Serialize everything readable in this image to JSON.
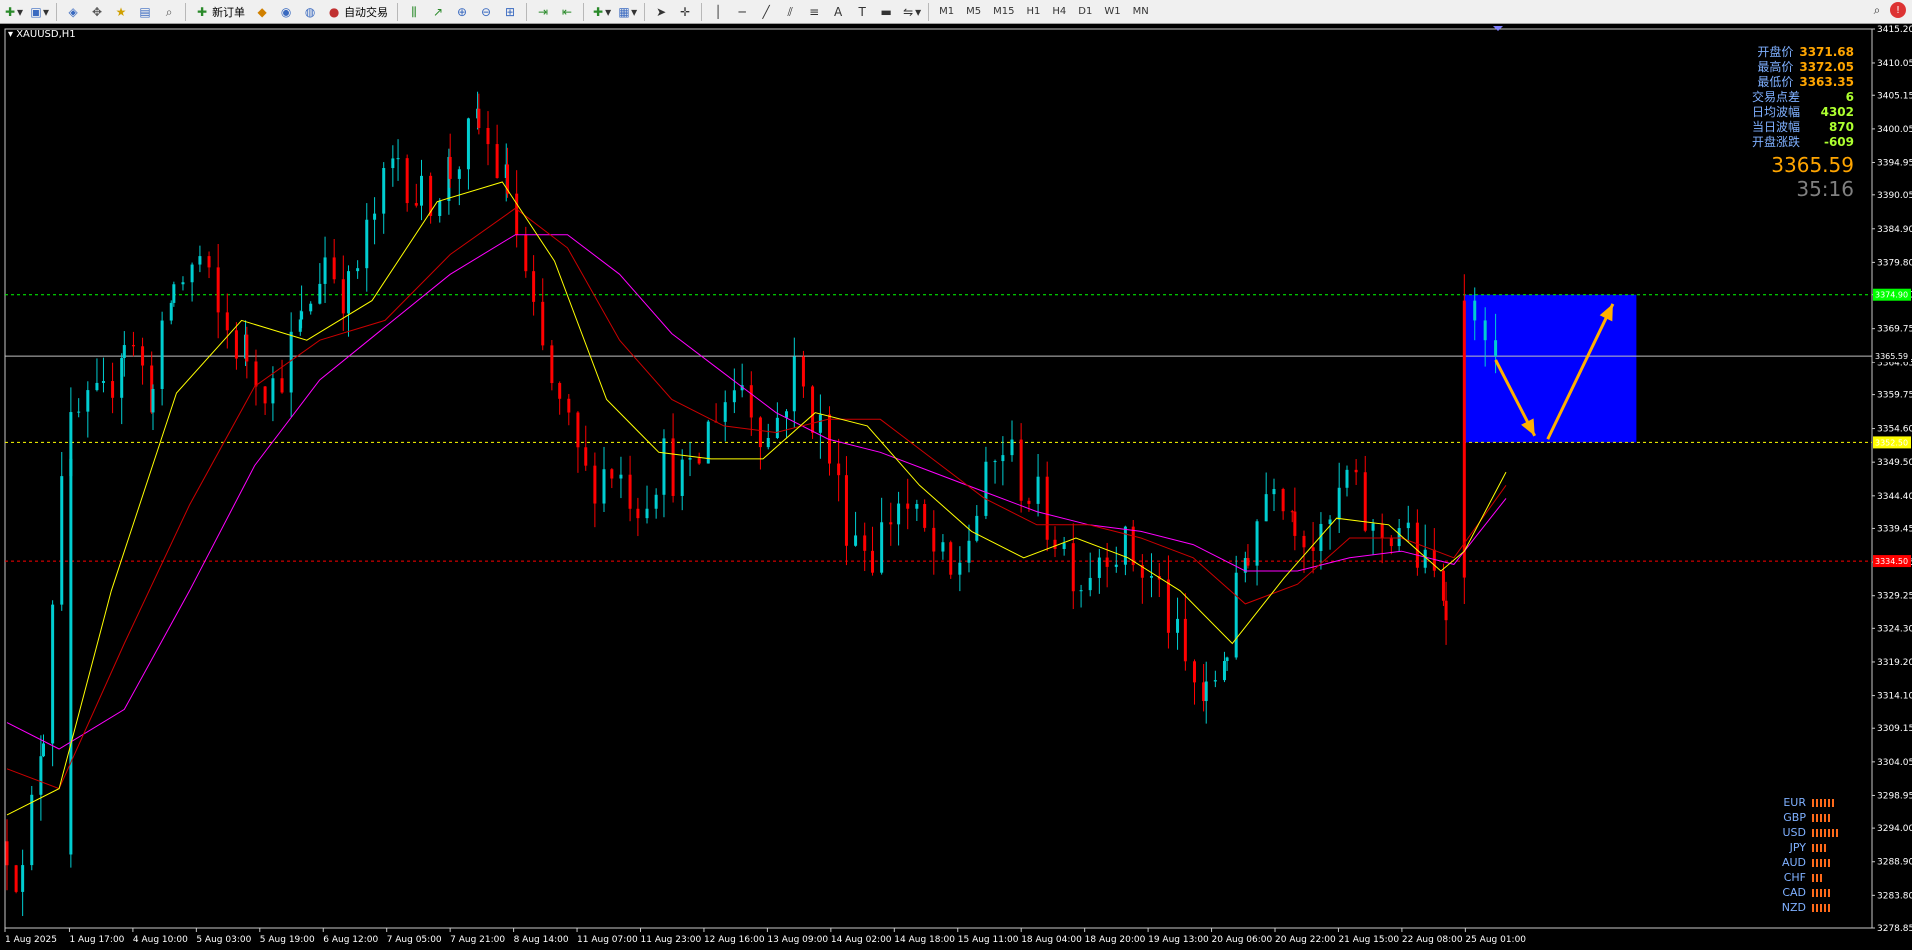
{
  "toolbar": {
    "new_order_label": "新订单",
    "auto_trading_label": "自动交易",
    "timeframes": [
      "M1",
      "M5",
      "M15",
      "H1",
      "H4",
      "D1",
      "W1",
      "MN"
    ]
  },
  "chart": {
    "symbol_label": "XAUUSD,H1",
    "colors": {
      "bull": "#00ced1",
      "bear": "#ff0000",
      "ma_fast": "#ffff00",
      "ma_mid": "#cc0000",
      "ma_slow": "#ff00ff",
      "box": "#0000ff",
      "arrow": "#ffb000"
    }
  },
  "info_panel": {
    "rows": [
      {
        "label": "开盘价",
        "value": "3371.68"
      },
      {
        "label": "最高价",
        "value": "3372.05"
      },
      {
        "label": "最低价",
        "value": "3363.35"
      },
      {
        "label": "交易点差",
        "value": "6"
      },
      {
        "label": "日均波幅",
        "value": "4302"
      },
      {
        "label": "当日波幅",
        "value": "870"
      },
      {
        "label": "开盘涨跌",
        "value": "-609"
      }
    ],
    "price": "3365.59",
    "countdown": "35:16"
  },
  "currency_strength": [
    {
      "currency": "EUR",
      "bars": 6
    },
    {
      "currency": "GBP",
      "bars": 5
    },
    {
      "currency": "USD",
      "bars": 7
    },
    {
      "currency": "JPY",
      "bars": 4
    },
    {
      "currency": "AUD",
      "bars": 5
    },
    {
      "currency": "CHF",
      "bars": 3
    },
    {
      "currency": "CAD",
      "bars": 5
    },
    {
      "currency": "NZD",
      "bars": 5
    }
  ],
  "chart_data": {
    "type": "candlestick",
    "price_axis_labels": [
      "3415.20",
      "3410.05",
      "3405.15",
      "3400.05",
      "3394.95",
      "3390.05",
      "3384.90",
      "3379.80",
      "3374.90",
      "3369.75",
      "3364.65",
      "3359.75",
      "3354.60",
      "3349.50",
      "3344.40",
      "3339.45",
      "3334.35",
      "3329.25",
      "3324.30",
      "3319.20",
      "3314.10",
      "3309.15",
      "3304.05",
      "3298.95",
      "3294.00",
      "3288.90",
      "3283.80",
      "3278.85"
    ],
    "ylim": [
      3278.85,
      3415.2
    ],
    "time_labels": [
      "1 Aug 2025",
      "1 Aug 17:00",
      "4 Aug 10:00",
      "5 Aug 03:00",
      "5 Aug 19:00",
      "6 Aug 12:00",
      "7 Aug 05:00",
      "7 Aug 21:00",
      "8 Aug 14:00",
      "11 Aug 07:00",
      "11 Aug 23:00",
      "12 Aug 16:00",
      "13 Aug 09:00",
      "14 Aug 02:00",
      "14 Aug 18:00",
      "15 Aug 11:00",
      "18 Aug 04:00",
      "18 Aug 20:00",
      "19 Aug 13:00",
      "20 Aug 06:00",
      "20 Aug 22:00",
      "21 Aug 15:00",
      "22 Aug 08:00",
      "25 Aug 01:00"
    ],
    "horizontal_lines": [
      {
        "price": 3374.9,
        "label": "3374.90",
        "color": "#00ff00",
        "style": "dashed"
      },
      {
        "price": 3365.59,
        "label": "3365.59",
        "color": "#c0c0c0",
        "style": "solid"
      },
      {
        "price": 3352.5,
        "label": "3352.50",
        "color": "#ffff00",
        "style": "dashed"
      },
      {
        "price": 3334.5,
        "label": "3334.50",
        "color": "#ff0000",
        "style": "dashed"
      }
    ],
    "anchors": [
      [
        0,
        3292
      ],
      [
        12,
        3286
      ],
      [
        28,
        3310
      ],
      [
        42,
        3350
      ],
      [
        55,
        3356
      ],
      [
        74,
        3358
      ],
      [
        90,
        3369
      ],
      [
        112,
        3360
      ],
      [
        128,
        3376
      ],
      [
        148,
        3380
      ],
      [
        162,
        3371
      ],
      [
        184,
        3366
      ],
      [
        204,
        3361
      ],
      [
        226,
        3370
      ],
      [
        244,
        3381
      ],
      [
        262,
        3375
      ],
      [
        282,
        3387
      ],
      [
        300,
        3396
      ],
      [
        318,
        3389
      ],
      [
        340,
        3394
      ],
      [
        362,
        3400
      ],
      [
        384,
        3391
      ],
      [
        404,
        3370
      ],
      [
        424,
        3357
      ],
      [
        444,
        3347
      ],
      [
        464,
        3349
      ],
      [
        484,
        3344
      ],
      [
        504,
        3350
      ],
      [
        524,
        3346
      ],
      [
        544,
        3358
      ],
      [
        564,
        3362
      ],
      [
        584,
        3353
      ],
      [
        604,
        3363
      ],
      [
        624,
        3355
      ],
      [
        644,
        3341
      ],
      [
        664,
        3336
      ],
      [
        684,
        3344
      ],
      [
        704,
        3338
      ],
      [
        724,
        3331
      ],
      [
        744,
        3342
      ],
      [
        764,
        3352
      ],
      [
        784,
        3345
      ],
      [
        804,
        3339
      ],
      [
        824,
        3332
      ],
      [
        844,
        3338
      ],
      [
        864,
        3335
      ],
      [
        884,
        3330
      ],
      [
        904,
        3318
      ],
      [
        920,
        3313
      ],
      [
        936,
        3322
      ],
      [
        952,
        3337
      ],
      [
        972,
        3349
      ],
      [
        988,
        3342
      ],
      [
        1008,
        3336
      ],
      [
        1028,
        3347
      ],
      [
        1048,
        3338
      ],
      [
        1068,
        3340
      ],
      [
        1088,
        3333
      ],
      [
        1104,
        3330
      ],
      [
        1110,
        3326
      ]
    ],
    "breakout_candles": [
      {
        "x": 1118,
        "open": 3332,
        "high": 3378,
        "low": 3328,
        "close": 3374
      },
      {
        "x": 1126,
        "open": 3374,
        "high": 3376,
        "low": 3368,
        "close": 3371
      },
      {
        "x": 1134,
        "open": 3371,
        "high": 3373,
        "low": 3364,
        "close": 3368
      },
      {
        "x": 1142,
        "open": 3368,
        "high": 3372,
        "low": 3363,
        "close": 3365.59
      }
    ],
    "ma_fast": [
      [
        0,
        3296
      ],
      [
        40,
        3300
      ],
      [
        80,
        3330
      ],
      [
        130,
        3360
      ],
      [
        180,
        3371
      ],
      [
        230,
        3368
      ],
      [
        280,
        3374
      ],
      [
        330,
        3389
      ],
      [
        380,
        3392
      ],
      [
        420,
        3380
      ],
      [
        460,
        3359
      ],
      [
        500,
        3351
      ],
      [
        540,
        3350
      ],
      [
        580,
        3350
      ],
      [
        620,
        3357
      ],
      [
        660,
        3355
      ],
      [
        700,
        3346
      ],
      [
        740,
        3339
      ],
      [
        780,
        3335
      ],
      [
        820,
        3338
      ],
      [
        860,
        3335
      ],
      [
        900,
        3330
      ],
      [
        940,
        3322
      ],
      [
        980,
        3332
      ],
      [
        1020,
        3341
      ],
      [
        1060,
        3340
      ],
      [
        1100,
        3333
      ],
      [
        1118,
        3336
      ],
      [
        1150,
        3348
      ]
    ],
    "ma_mid": [
      [
        0,
        3303
      ],
      [
        40,
        3300
      ],
      [
        90,
        3322
      ],
      [
        140,
        3343
      ],
      [
        190,
        3361
      ],
      [
        240,
        3368
      ],
      [
        290,
        3371
      ],
      [
        340,
        3381
      ],
      [
        390,
        3388
      ],
      [
        430,
        3382
      ],
      [
        470,
        3368
      ],
      [
        510,
        3359
      ],
      [
        550,
        3355
      ],
      [
        590,
        3354
      ],
      [
        630,
        3356
      ],
      [
        670,
        3356
      ],
      [
        710,
        3350
      ],
      [
        750,
        3344
      ],
      [
        790,
        3340
      ],
      [
        830,
        3340
      ],
      [
        870,
        3338
      ],
      [
        910,
        3335
      ],
      [
        950,
        3328
      ],
      [
        990,
        3331
      ],
      [
        1030,
        3338
      ],
      [
        1070,
        3338
      ],
      [
        1110,
        3335
      ],
      [
        1150,
        3346
      ]
    ],
    "ma_slow": [
      [
        0,
        3310
      ],
      [
        40,
        3306
      ],
      [
        90,
        3312
      ],
      [
        140,
        3330
      ],
      [
        190,
        3349
      ],
      [
        240,
        3362
      ],
      [
        290,
        3370
      ],
      [
        340,
        3378
      ],
      [
        390,
        3384
      ],
      [
        430,
        3384
      ],
      [
        470,
        3378
      ],
      [
        510,
        3369
      ],
      [
        550,
        3363
      ],
      [
        590,
        3357
      ],
      [
        630,
        3353
      ],
      [
        670,
        3351
      ],
      [
        710,
        3348
      ],
      [
        750,
        3345
      ],
      [
        790,
        3342
      ],
      [
        830,
        3340
      ],
      [
        870,
        3339
      ],
      [
        910,
        3337
      ],
      [
        950,
        3333
      ],
      [
        990,
        3333
      ],
      [
        1030,
        3335
      ],
      [
        1070,
        3336
      ],
      [
        1110,
        3334
      ],
      [
        1150,
        3344
      ]
    ],
    "box": {
      "x_start": 1118,
      "x_end": 1250,
      "price_top": 3374.9,
      "price_bottom": 3352.5
    },
    "arrows": [
      {
        "x1": 1142,
        "p1": 3365.0,
        "x2": 1172,
        "p2": 3353.5
      },
      {
        "x1": 1182,
        "p1": 3353.0,
        "x2": 1232,
        "p2": 3373.5
      }
    ]
  }
}
